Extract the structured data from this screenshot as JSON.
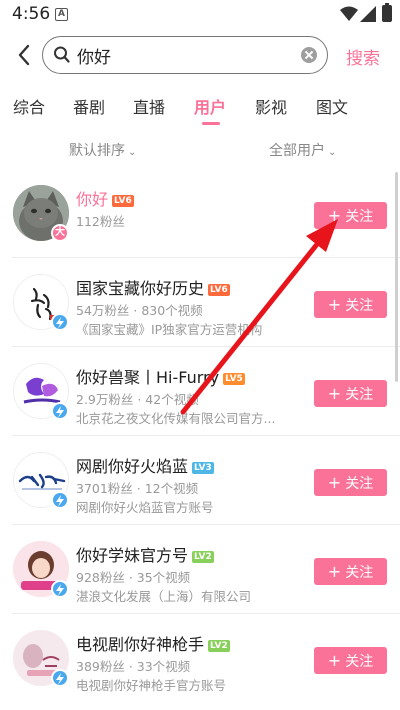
{
  "status_bar": {
    "time": "4:56",
    "notification_letter": "A"
  },
  "search": {
    "query": "你好",
    "submit_label": "搜索"
  },
  "tabs": [
    {
      "label": "综合"
    },
    {
      "label": "番剧"
    },
    {
      "label": "直播"
    },
    {
      "label": "用户",
      "active": true
    },
    {
      "label": "影视"
    },
    {
      "label": "图文"
    }
  ],
  "filters": {
    "sort": "默认排序",
    "user_type": "全部用户"
  },
  "users": [
    {
      "name": "你好",
      "level": "LV6",
      "stats": "112粉丝",
      "desc": "",
      "badge": "大",
      "follow_label": "关注"
    },
    {
      "name": "国家宝藏你好历史",
      "level": "LV6",
      "stats": "54万粉丝 · 830个视频",
      "desc": "《国家宝藏》IP独家官方运营机构",
      "follow_label": "关注"
    },
    {
      "name": "你好兽聚丨Hi-Furry",
      "level": "LV5",
      "stats": "2.9万粉丝 · 42个视频",
      "desc": "北京花之夜文化传媒有限公司官方...",
      "follow_label": "关注"
    },
    {
      "name": "网剧你好火焰蓝",
      "level": "LV3",
      "stats": "3701粉丝 · 12个视频",
      "desc": "网剧你好火焰蓝官方账号",
      "follow_label": "关注"
    },
    {
      "name": "你好学妹官方号",
      "level": "LV2",
      "stats": "928粉丝 · 35个视频",
      "desc": "湛浪文化发展（上海）有限公司",
      "follow_label": "关注"
    },
    {
      "name": "电视剧你好神枪手",
      "level": "LV2",
      "stats": "389粉丝 · 33个视频",
      "desc": "电视剧你好神枪手官方账号",
      "follow_label": "关注"
    }
  ],
  "colors": {
    "accent": "#fb7299",
    "arrow": "#e8141c"
  }
}
